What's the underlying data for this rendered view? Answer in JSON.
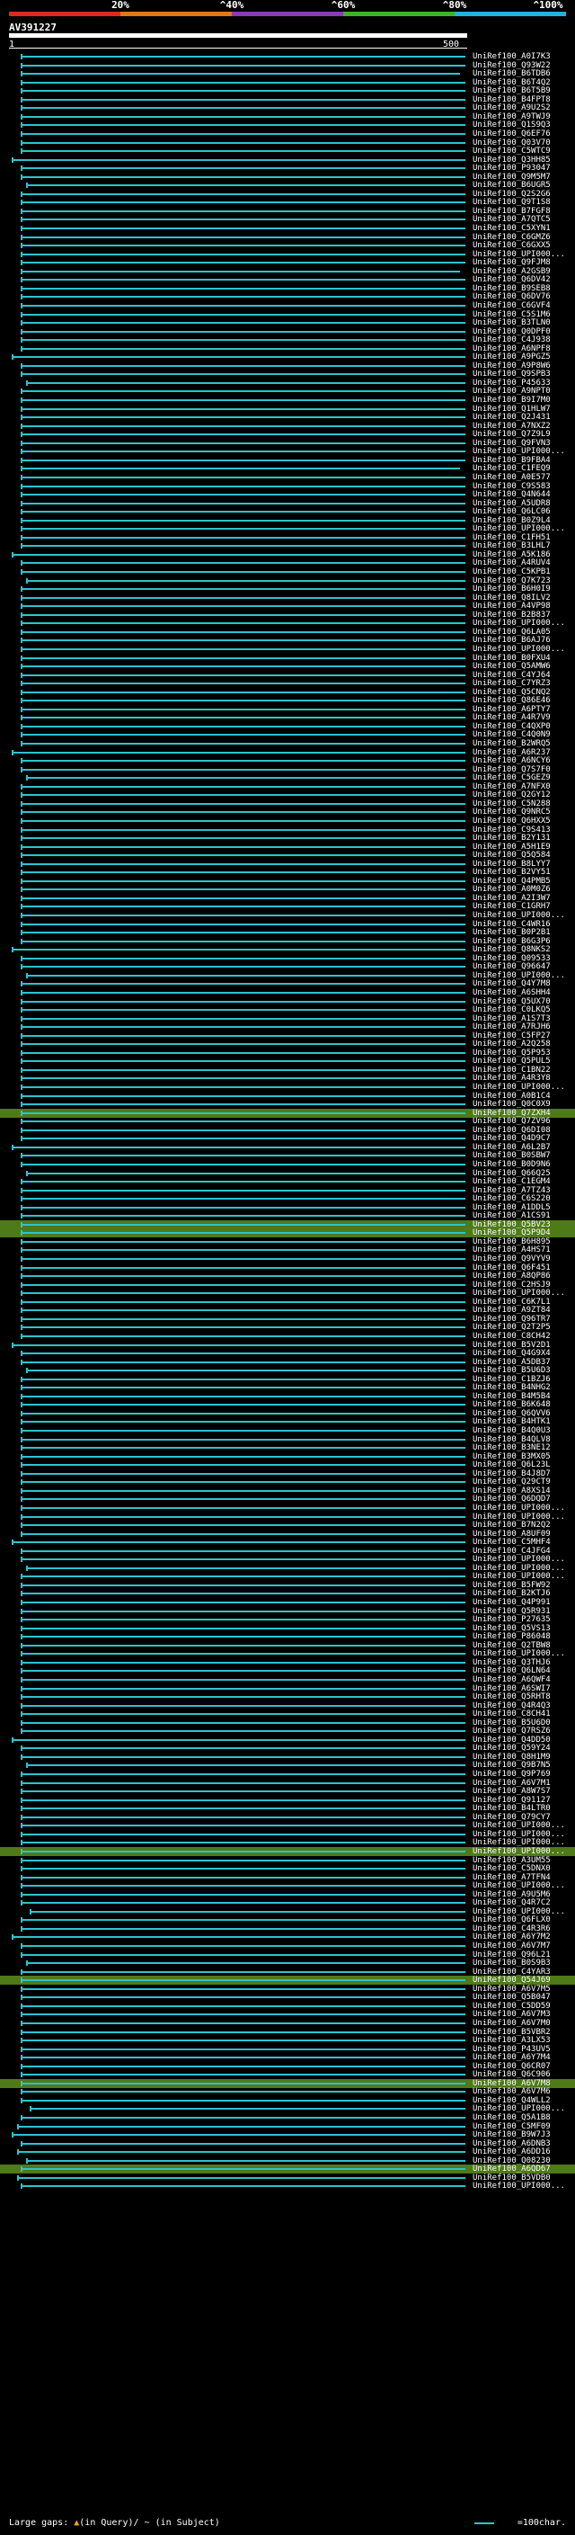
{
  "scale": {
    "ticks": [
      {
        "label": "20%",
        "pos": 0.2
      },
      {
        "label": "^40%",
        "pos": 0.4
      },
      {
        "label": "^60%",
        "pos": 0.6
      },
      {
        "label": "^80%",
        "pos": 0.8
      },
      {
        "label": "^100%",
        "pos": 1.0
      }
    ],
    "colors": [
      "#e0281e",
      "#e07818",
      "#8a3cb4",
      "#3cb428",
      "#1eb4dc"
    ]
  },
  "query": {
    "name": "AV391227",
    "start": "1",
    "end": "500"
  },
  "legend": {
    "left": "Large gaps: ",
    "gap_desc": "(in Query)/ ~ (in Subject)",
    "right": "=100char."
  },
  "hits": [
    "UniRef100_A0I7K3",
    "UniRef100_Q93W22",
    "UniRef100_B6TDB6",
    "UniRef100_B6T4Q2",
    "UniRef100_B6T5B9",
    "UniRef100_B4FPT8",
    "UniRef100_A9U2S2",
    "UniRef100_A9TWJ9",
    "UniRef100_Q1S9Q3",
    "UniRef100_Q6EF76",
    "UniRef100_Q03V70",
    "UniRef100_C5WTC9",
    "UniRef100_Q3HH85",
    "UniRef100_P93047",
    "UniRef100_Q9M5M7",
    "UniRef100_B6UGR5",
    "UniRef100_Q2S2G6",
    "UniRef100_Q9T1S8",
    "UniRef100_B7FGF8",
    "UniRef100_A7QTC5",
    "UniRef100_C5XYN1",
    "UniRef100_C6GMZ6",
    "UniRef100_C6GXX5",
    "UniRef100_UPI000...",
    "UniRef100_Q9FJM8",
    "UniRef100_A2GSB9",
    "UniRef100_Q6DV42",
    "UniRef100_B9SEB8",
    "UniRef100_Q6DV76",
    "UniRef100_C6GVF4",
    "UniRef100_C5S1M6",
    "UniRef100_B3TLN0",
    "UniRef100_Q0DPF0",
    "UniRef100_C4J938",
    "UniRef100_A6NPF8",
    "UniRef100_A9PGZ5",
    "UniRef100_A9P8W6",
    "UniRef100_Q9SPB3",
    "UniRef100_P45633",
    "UniRef100_A9NPT0",
    "UniRef100_B9I7M0",
    "UniRef100_Q1HLW7",
    "UniRef100_Q2J431",
    "UniRef100_A7NXZ2",
    "UniRef100_Q7Z9L9",
    "UniRef100_Q9FVN3",
    "UniRef100_UPI000...",
    "UniRef100_B9FBA4",
    "UniRef100_C1FEQ9",
    "UniRef100_A0E577",
    "UniRef100_C9S583",
    "UniRef100_Q4N644",
    "UniRef100_A5UDR8",
    "UniRef100_Q6LC06",
    "UniRef100_B0Z9L4",
    "UniRef100_UPI000...",
    "UniRef100_C1FH51",
    "UniRef100_B3LHL7",
    "UniRef100_A5K186",
    "UniRef100_A4RUV4",
    "UniRef100_C5KPB1",
    "UniRef100_Q7K723",
    "UniRef100_B6H0I9",
    "UniRef100_Q8ILV2",
    "UniRef100_A4VP98",
    "UniRef100_B2B837",
    "UniRef100_UPI000...",
    "UniRef100_Q6LA05",
    "UniRef100_B6AJ76",
    "UniRef100_UPI000...",
    "UniRef100_B0FXU4",
    "UniRef100_Q5AMW6",
    "UniRef100_C4YJ64",
    "UniRef100_C7YRZ3",
    "UniRef100_Q5CNQ2",
    "UniRef100_Q86E46",
    "UniRef100_A6PTY7",
    "UniRef100_A4R7V9",
    "UniRef100_C4QXP0",
    "UniRef100_C4Q0N9",
    "UniRef100_B2WRQ5",
    "UniRef100_A6R237",
    "UniRef100_A6NCY6",
    "UniRef100_Q7S7F0",
    "UniRef100_C5GEZ9",
    "UniRef100_A7NFX0",
    "UniRef100_Q2GY12",
    "UniRef100_C5N288",
    "UniRef100_Q9NRC5",
    "UniRef100_Q6HXX5",
    "UniRef100_C9S413",
    "UniRef100_B2Y131",
    "UniRef100_A5H1E9",
    "UniRef100_Q5Q584",
    "UniRef100_B8LYY7",
    "UniRef100_B2VY51",
    "UniRef100_Q4PMB5",
    "UniRef100_A0M0Z6",
    "UniRef100_A2I3W7",
    "UniRef100_C1GRH7",
    "UniRef100_UPI000...",
    "UniRef100_C4WR16",
    "UniRef100_B0P2B1",
    "UniRef100_B6G3P6",
    "UniRef100_Q8NKS2",
    "UniRef100_Q09533",
    "UniRef100_Q96647",
    "UniRef100_UPI000...",
    "UniRef100_Q4Y7M8",
    "UniRef100_A6SHH4",
    "UniRef100_Q5UX70",
    "UniRef100_C0LKQ5",
    "UniRef100_A1S7T3",
    "UniRef100_A7RJH6",
    "UniRef100_C5FP27",
    "UniRef100_A2Q258",
    "UniRef100_Q5P953",
    "UniRef100_Q5PUL5",
    "UniRef100_C1BN22",
    "UniRef100_A4R3Y8",
    "UniRef100_UPI000...",
    "UniRef100_A0B1C4",
    "UniRef100_Q0C0X9",
    "UniRef100_Q7ZXH4",
    "UniRef100_Q7ZV96",
    "UniRef100_Q6DI08",
    "UniRef100_Q4D9C7",
    "UniRef100_A6L2B7",
    "UniRef100_B0SBW7",
    "UniRef100_B0D9N6",
    "UniRef100_Q66Q25",
    "UniRef100_C1EGM4",
    "UniRef100_A7TZ43",
    "UniRef100_C6S220",
    "UniRef100_A1DDL5",
    "UniRef100_A1CS91",
    "UniRef100_Q5BV23",
    "UniRef100_Q5P9D4",
    "UniRef100_B6H895",
    "UniRef100_A4HS71",
    "UniRef100_Q9VYV9",
    "UniRef100_Q6F451",
    "UniRef100_A8QP86",
    "UniRef100_C2HSJ9",
    "UniRef100_UPI000...",
    "UniRef100_C6K7L1",
    "UniRef100_A9ZT84",
    "UniRef100_Q96TR7",
    "UniRef100_Q2T2P5",
    "UniRef100_C8CH42",
    "UniRef100_B5V2D1",
    "UniRef100_Q4G9X4",
    "UniRef100_A5DB37",
    "UniRef100_B5U6D3",
    "UniRef100_C1BZJ6",
    "UniRef100_B4NHG2",
    "UniRef100_B4M5B4",
    "UniRef100_B6K648",
    "UniRef100_Q6QVV6",
    "UniRef100_B4HTK1",
    "UniRef100_B4Q0U3",
    "UniRef100_B4QLV8",
    "UniRef100_B3NE12",
    "UniRef100_B3MX05",
    "UniRef100_Q6L23L",
    "UniRef100_B4J8D7",
    "UniRef100_Q29CT9",
    "UniRef100_A8XS14",
    "UniRef100_Q6DQD7",
    "UniRef100_UPI000...",
    "UniRef100_UPI000...",
    "UniRef100_B7N2Q2",
    "UniRef100_A8UF09",
    "UniRef100_C5MHF4",
    "UniRef100_C4JFG4",
    "UniRef100_UPI000...",
    "UniRef100_UPI000...",
    "UniRef100_UPI000...",
    "UniRef100_B5FW92",
    "UniRef100_B2KTJ6",
    "UniRef100_Q4P991",
    "UniRef100_Q5R931",
    "UniRef100_P27635",
    "UniRef100_Q5VS13",
    "UniRef100_P86048",
    "UniRef100_Q2TBW8",
    "UniRef100_UPI000...",
    "UniRef100_Q3THJ6",
    "UniRef100_Q6LN64",
    "UniRef100_A6QWF4",
    "UniRef100_A6SWI7",
    "UniRef100_Q5RHT8",
    "UniRef100_Q4R4Q3",
    "UniRef100_C8CH41",
    "UniRef100_B5U6D0",
    "UniRef100_Q7RSZ6",
    "UniRef100_Q4DD50",
    "UniRef100_Q59Y24",
    "UniRef100_Q8H1M9",
    "UniRef100_Q9B7N5",
    "UniRef100_Q9P769",
    "UniRef100_A6V7M1",
    "UniRef100_A8W7S7",
    "UniRef100_Q91127",
    "UniRef100_B4LTR0",
    "UniRef100_Q79CY7",
    "UniRef100_UPI000...",
    "UniRef100_UPI000...",
    "UniRef100_UPI000...",
    "UniRef100_UPI000...",
    "UniRef100_A3UM55",
    "UniRef100_C5DNX0",
    "UniRef100_A7TFN4",
    "UniRef100_UPI000...",
    "UniRef100_A9U5M6",
    "UniRef100_Q4R7C2",
    "UniRef100_UPI000...",
    "UniRef100_Q6FLX0",
    "UniRef100_C4R3R6",
    "UniRef100_A6Y7M2",
    "UniRef100_A6V7M7",
    "UniRef100_Q96L21",
    "UniRef100_B0S9B3",
    "UniRef100_C4YAR3",
    "UniRef100_Q54J69",
    "UniRef100_A6V7M5",
    "UniRef100_Q5B047",
    "UniRef100_C5DD59",
    "UniRef100_A6V7M3",
    "UniRef100_A6V7M0",
    "UniRef100_B5VBR2",
    "UniRef100_A3LX53",
    "UniRef100_P43UV5",
    "UniRef100_A6Y7M4",
    "UniRef100_Q6CR07",
    "UniRef100_Q6C906",
    "UniRef100_A6V7M8",
    "UniRef100_A6V7M6",
    "UniRef100_Q4WLL2",
    "UniRef100_UPI000...",
    "UniRef100_Q5A1B8",
    "UniRef100_C5MF09",
    "UniRef100_B9W7J3",
    "UniRef100_A6DNB3",
    "UniRef100_A6DD16",
    "UniRef100_Q08230",
    "UniRef100_A6QD67",
    "UniRef100_B5VDB0",
    "UniRef100_UPI000..."
  ],
  "green_rows": [
    123,
    136,
    137,
    209,
    224,
    236,
    246,
    253,
    256
  ]
}
